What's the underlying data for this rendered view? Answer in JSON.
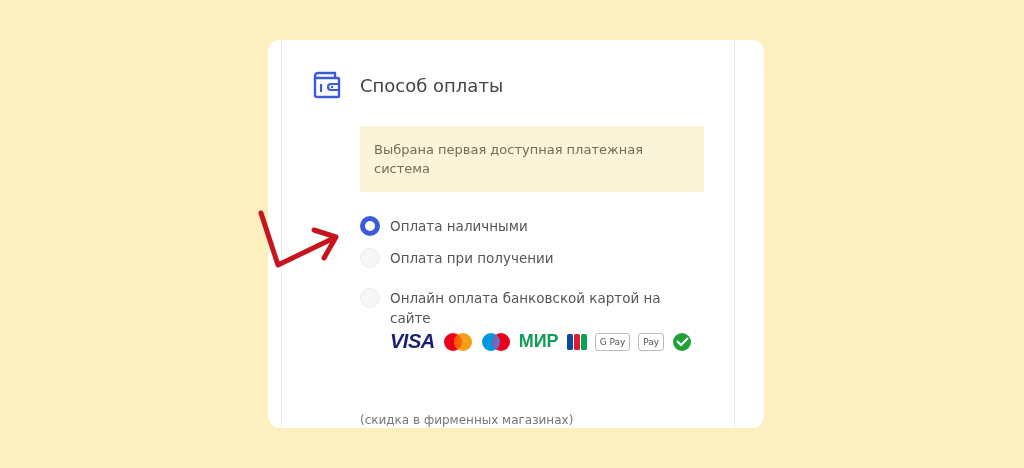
{
  "section": {
    "title": "Способ оплаты"
  },
  "notice": "Выбрана первая доступная платежная система",
  "options": [
    {
      "label": "Оплата наличными",
      "selected": true
    },
    {
      "label": "Оплата при получении",
      "selected": false
    },
    {
      "label": "Онлайн оплата банковской картой на сайте",
      "selected": false
    }
  ],
  "payment_logos": [
    {
      "kind": "visa",
      "label": "VISA"
    },
    {
      "kind": "mastercard"
    },
    {
      "kind": "maestro"
    },
    {
      "kind": "mir",
      "label": "МИР"
    },
    {
      "kind": "jcb"
    },
    {
      "kind": "gpay",
      "label": "G Pay"
    },
    {
      "kind": "applepay",
      "label": "Pay"
    },
    {
      "kind": "sber"
    }
  ],
  "footnote": "(скидка в фирменных магазинах)"
}
